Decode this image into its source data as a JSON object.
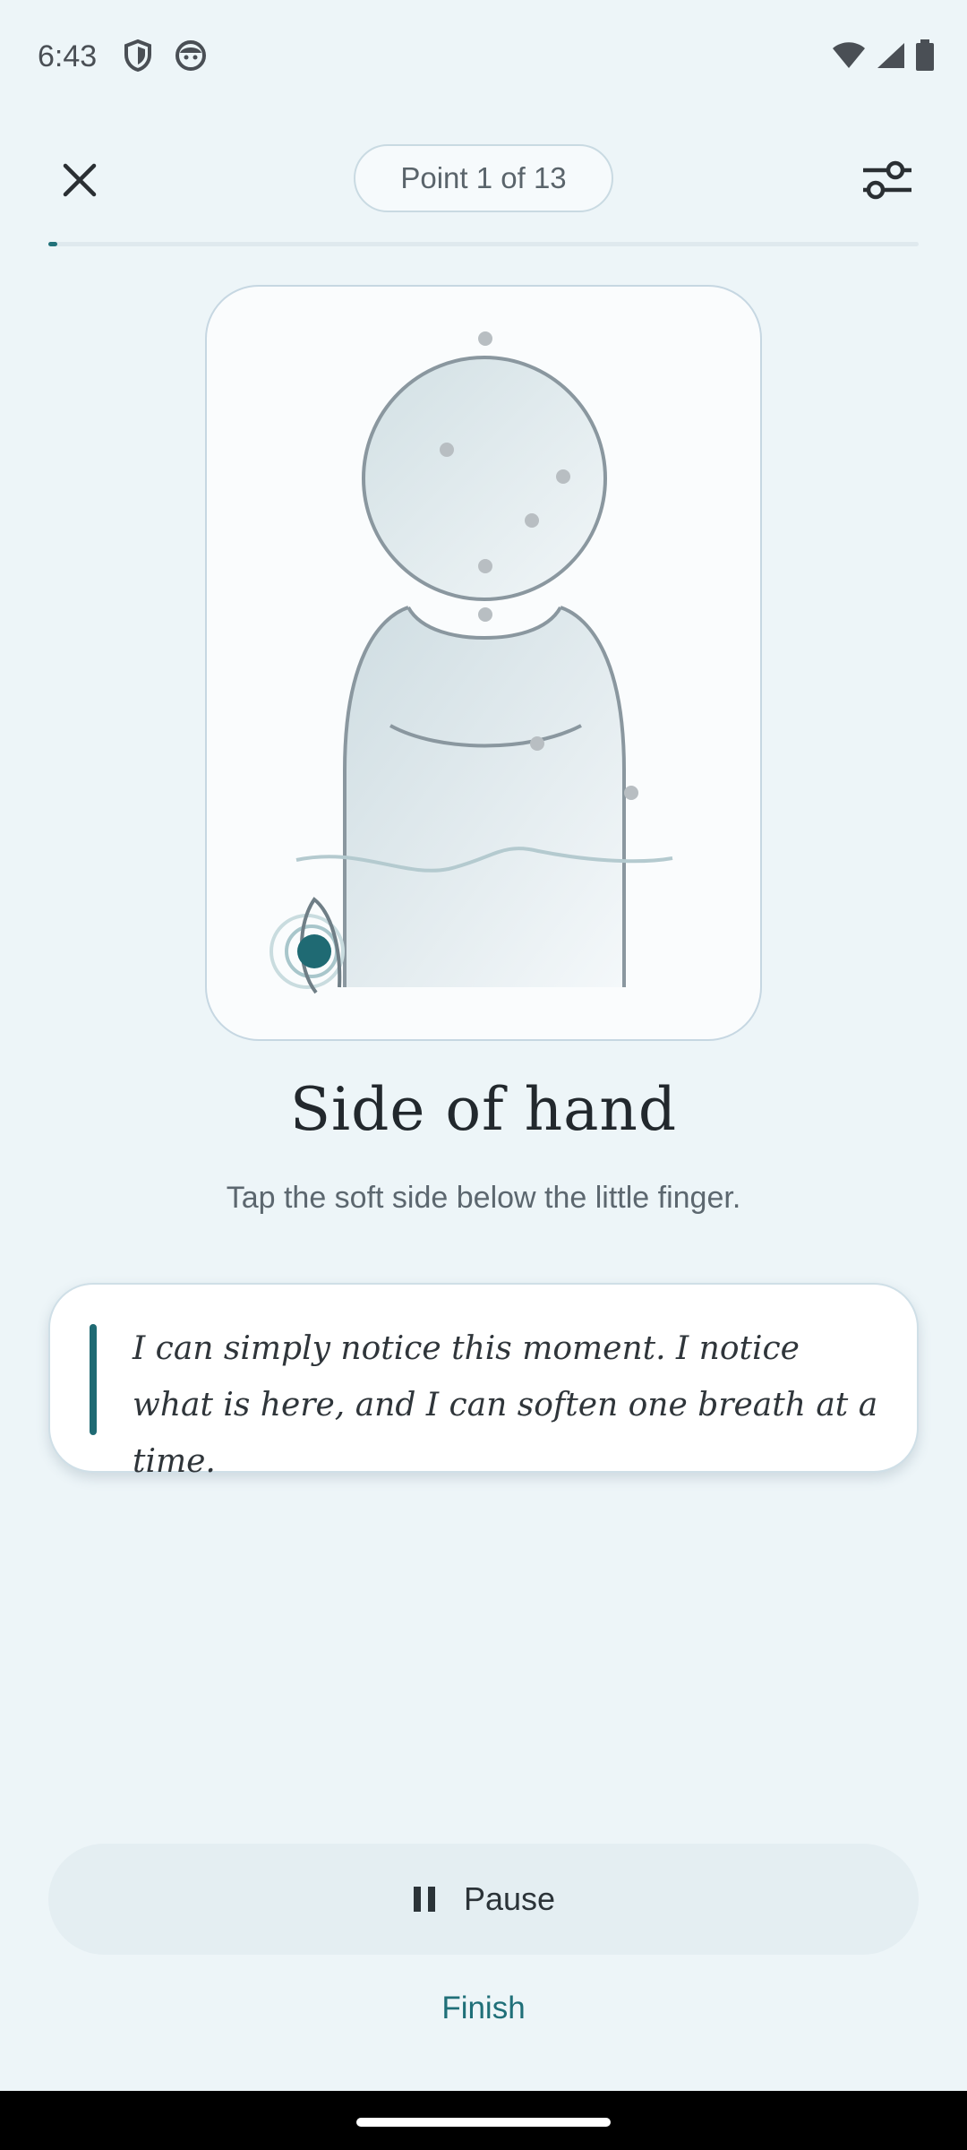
{
  "status_bar": {
    "time": "6:43",
    "left_icons": [
      "shield-icon",
      "face-icon"
    ],
    "right_icons": [
      "wifi-icon",
      "signal-icon",
      "battery-icon"
    ]
  },
  "top_bar": {
    "close_icon": "close-icon",
    "point_counter": "Point 1 of 13",
    "settings_icon": "tune-icon"
  },
  "progress": {
    "current": 1,
    "total": 13,
    "color": "#22727a"
  },
  "illustration": {
    "active_point": "side-of-hand",
    "accent": "#1f6a73"
  },
  "point": {
    "title": "Side of hand",
    "instruction": "Tap the soft side below the little finger."
  },
  "affirmation": {
    "text": "I can simply notice this moment. I notice what is here, and I can soften one breath at a time."
  },
  "controls": {
    "pause_label": "Pause",
    "pause_icon": "pause-icon",
    "finish_label": "Finish"
  },
  "colors": {
    "background": "#edf5f8",
    "accent": "#1f6f78"
  }
}
